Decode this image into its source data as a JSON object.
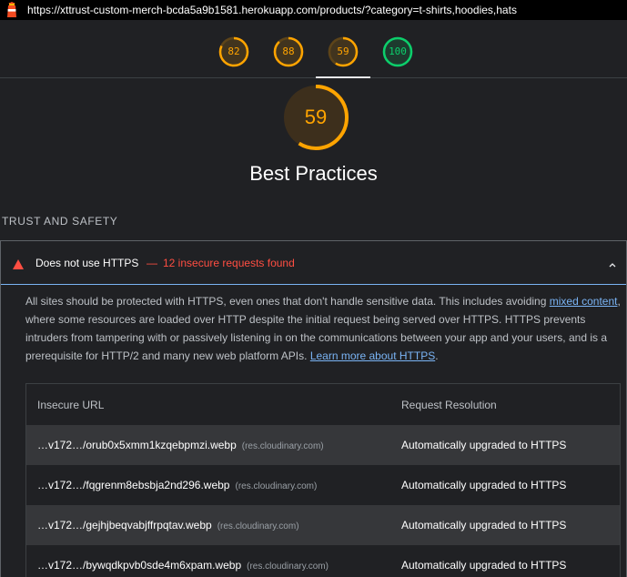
{
  "address_bar": {
    "url": "https://xttrust-custom-merch-bcda5a9b1581.herokuapp.com/products/?category=t-shirts,hoodies,hats"
  },
  "score_gauges": [
    {
      "value": "82",
      "score": 0.82,
      "color": "#ffa400"
    },
    {
      "value": "88",
      "score": 0.88,
      "color": "#ffa400"
    },
    {
      "value": "59",
      "score": 0.59,
      "color": "#ffa400"
    },
    {
      "value": "100",
      "score": 1.0,
      "color": "#0cce6b"
    }
  ],
  "category": {
    "score": "59",
    "score_fraction": 0.59,
    "title": "Best Practices",
    "color": "#ffa400"
  },
  "section": {
    "label": "TRUST AND SAFETY"
  },
  "audit": {
    "icon": "warning-triangle-icon",
    "title": "Does not use HTTPS",
    "separator": "—",
    "display_value": "12 insecure requests found",
    "fail_color": "#ff4e42",
    "description_parts": {
      "p1": "All sites should be protected with HTTPS, even ones that don't handle sensitive data. This includes avoiding ",
      "link1": "mixed content",
      "p2": ", where some resources are loaded over HTTP despite the initial request being served over HTTPS. HTTPS prevents intruders from tampering with or passively listening in on the communications between your app and your users, and is a prerequisite for HTTP/2 and many new web platform APIs. ",
      "link2": "Learn more about HTTPS",
      "p3": "."
    },
    "table": {
      "headers": [
        "Insecure URL",
        "Request Resolution"
      ],
      "rows": [
        {
          "url": "…v172…/orub0x5xmm1kzqebpmzi.webp",
          "host": "(res.cloudinary.com)",
          "resolution": "Automatically upgraded to HTTPS"
        },
        {
          "url": "…v172…/fqgrenm8ebsbja2nd296.webp",
          "host": "(res.cloudinary.com)",
          "resolution": "Automatically upgraded to HTTPS"
        },
        {
          "url": "…v172…/gejhjbeqvabjffrpqtav.webp",
          "host": "(res.cloudinary.com)",
          "resolution": "Automatically upgraded to HTTPS"
        },
        {
          "url": "…v172…/bywqdkpvb0sde4m6xpam.webp",
          "host": "(res.cloudinary.com)",
          "resolution": "Automatically upgraded to HTTPS"
        }
      ]
    }
  }
}
